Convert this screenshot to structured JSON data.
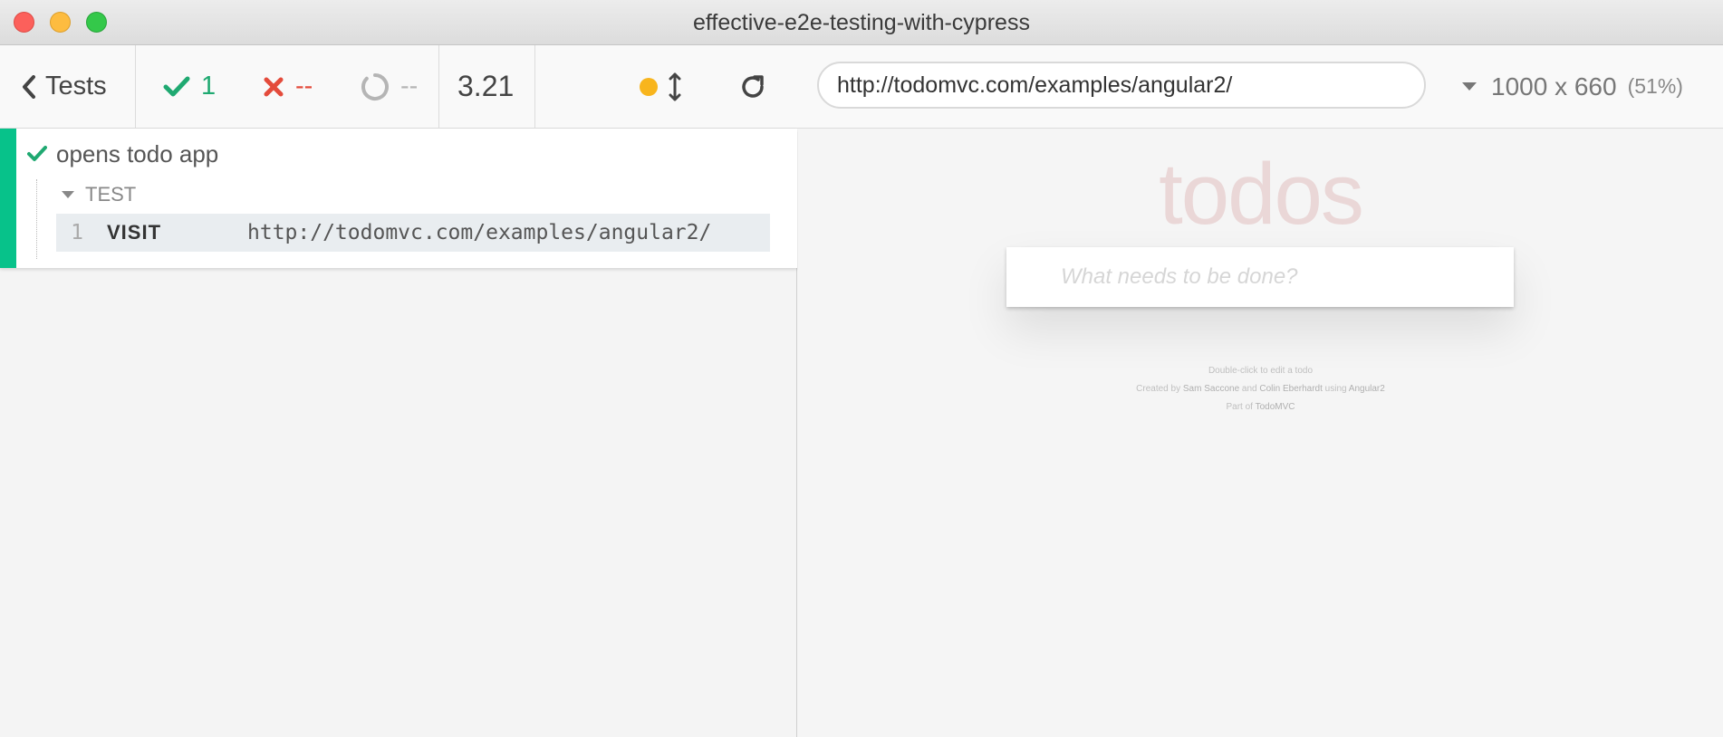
{
  "window": {
    "title": "effective-e2e-testing-with-cypress"
  },
  "toolbar": {
    "tests_label": "Tests",
    "passed_count": "1",
    "failed_count": "--",
    "pending_count": "--",
    "duration": "3.21",
    "url": "http://todomvc.com/examples/angular2/",
    "viewport": "1000 x 660",
    "scale": "(51%)",
    "colors": {
      "passed": "#1fa971",
      "failed": "#e44b3b",
      "pending": "#b5b5b5",
      "auto_scroll": "#f8b51d"
    }
  },
  "reporter": {
    "test": {
      "title": "opens todo app",
      "state": "passed",
      "state_color": "#07c28a",
      "hook_label": "TEST",
      "commands": [
        {
          "number": "1",
          "name": "VISIT",
          "message": "http://todomvc.com/examples/angular2/"
        }
      ]
    }
  },
  "preview": {
    "heading": "todos",
    "new_todo_placeholder": "What needs to be done?",
    "info_line1": "Double-click to edit a todo",
    "info_created_by": "Created by",
    "info_author1": "Sam Saccone",
    "info_and": "and",
    "info_author2": "Colin Eberhardt",
    "info_using": "using",
    "info_framework": "Angular2",
    "info_part_of": "Part of",
    "info_todomvc": "TodoMVC"
  }
}
